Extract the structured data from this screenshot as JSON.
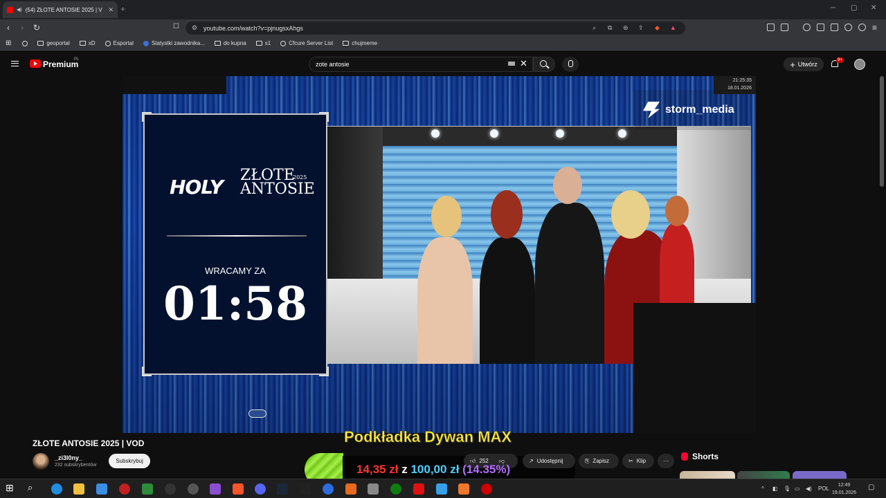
{
  "browser": {
    "tab_title": "(54) ZŁOTE ANTOSIE 2025 | V",
    "url": "youtube.com/watch?v=pjnugsxAhgs",
    "bookmarks": [
      "geoportal",
      "xD",
      "Esportal",
      "Statystki zawodnika...",
      "do kupna",
      "s1",
      "Cfcure Server List",
      "chujmeme"
    ]
  },
  "yt": {
    "brand": "Premium",
    "region": "PL",
    "search_value": "zote antosie",
    "create_label": "Utwórz",
    "notif_count": "9+"
  },
  "player": {
    "timestamp_time": "21:25:35",
    "timestamp_date": "18.01.2026",
    "logo_left": "HOLY",
    "logo_right_l1": "ZŁOTE",
    "logo_right_l2": "ANTOSIE",
    "logo_year": "2025",
    "wracamy": "WRACAMY ZA",
    "countdown": "01:58",
    "watermark": "storm_media"
  },
  "video": {
    "title": "ZŁOTE ANTOSIE 2025 | VOD",
    "channel": "_zi3l0ny_",
    "subscribers": "232 subskrybentów",
    "subscribe_label": "Subskrybuj",
    "likes": "252",
    "share_label": "Udostępnij",
    "save_label": "Zapisz",
    "clip_label": "Klip",
    "more_label": "···"
  },
  "donation": {
    "title": "Podkładka Dywan MAX",
    "current": "14,35 zł",
    "of": "z",
    "goal": "100,00 zł",
    "percent": "(14.35%)"
  },
  "sidebar": {
    "shorts_label": "Shorts"
  },
  "taskbar": {
    "lang": "POL",
    "time": "12:49",
    "date": "19.01.2026"
  },
  "colors": {
    "yt_red": "#ff0000",
    "donation_current": "#ff3333",
    "donation_goal": "#4dd0ff",
    "donation_percent": "#b36bff",
    "overlay_title": "#ffeb3b"
  }
}
